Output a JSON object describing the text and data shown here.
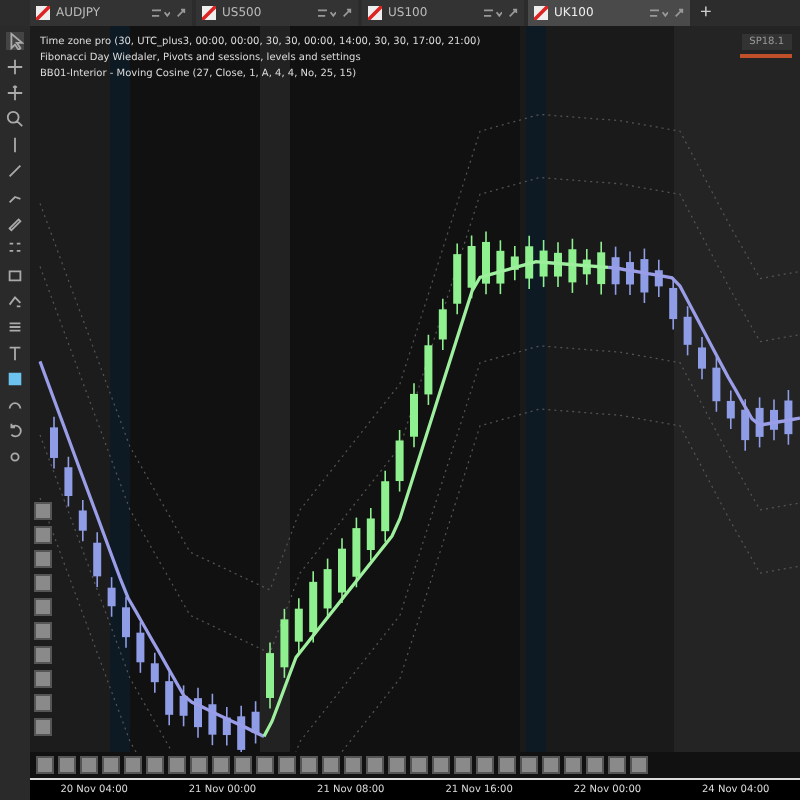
{
  "tabs": [
    {
      "symbol": "AUDJPY",
      "selected": false
    },
    {
      "symbol": "US500",
      "selected": false
    },
    {
      "symbol": "US100",
      "selected": false
    },
    {
      "symbol": "UK100",
      "selected": true
    }
  ],
  "new_tab": "+",
  "legend": [
    "Time zone pro (30, UTC_plus3, 00:00, 00:00, 30, 30, 00:00, 14:00, 30, 30, 17:00, 21:00)",
    "Fibonacci Day Wiedaler, Pivots and sessions, levels and settings",
    "BB01-Interior - Moving Cosine (27, Close, 1, A, 4, 4, No, 25, 15)"
  ],
  "badge": "SP18.1",
  "time_axis": [
    "20 Nov 04:00",
    "21 Nov 00:00",
    "21 Nov 08:00",
    "21 Nov 16:00",
    "22 Nov 00:00",
    "24 Nov 04:00"
  ]
}
